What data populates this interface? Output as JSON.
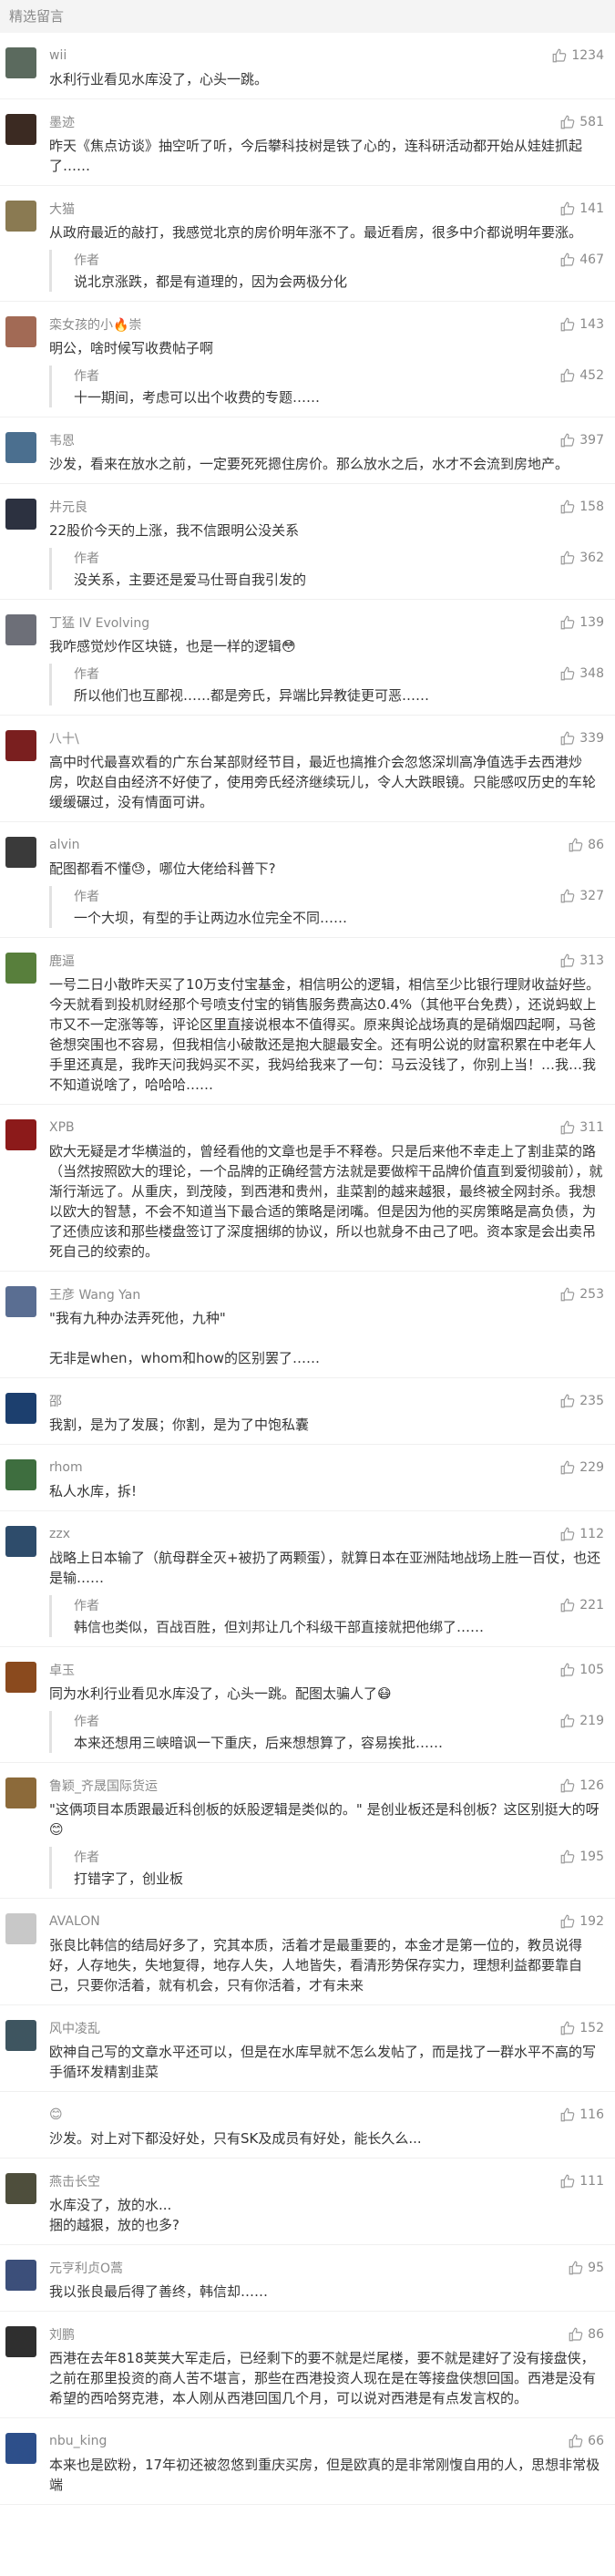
{
  "section_title": "精选留言",
  "comments": [
    {
      "nick": "wii",
      "likes": "1234",
      "text": "水利行业看见水库没了，心头一跳。",
      "color": "#5b6a5e"
    },
    {
      "nick": "墨迹",
      "likes": "581",
      "text": "昨天《焦点访谈》抽空听了听，今后攀科技树是铁了心的，连科研活动都开始从娃娃抓起了……",
      "color": "#3b2a22"
    },
    {
      "nick": "大猫",
      "likes": "141",
      "text": "从政府最近的敲打，我感觉北京的房价明年涨不了。最近看房，很多中介都说明年要涨。",
      "reply_author": "作者",
      "reply_likes": "467",
      "reply_text": "说北京涨跌，都是有道理的，因为会两极分化",
      "color": "#8a7a52"
    },
    {
      "nick": "栾女孩的小🔥崇",
      "likes": "143",
      "text": "明公，啥时候写收费帖子啊",
      "reply_author": "作者",
      "reply_likes": "452",
      "reply_text": "十一期间，考虑可以出个收费的专题……",
      "color": "#a26a55"
    },
    {
      "nick": "韦恩",
      "likes": "397",
      "text": "沙发，看来在放水之前，一定要死死摁住房价。那么放水之后，水才不会流到房地产。",
      "color": "#4b6f8f"
    },
    {
      "nick": "井元良",
      "likes": "158",
      "text": "22股价今天的上涨，我不信跟明公没关系",
      "reply_author": "作者",
      "reply_likes": "362",
      "reply_text": "没关系，主要还是爱马仕哥自我引发的",
      "color": "#2c3140"
    },
    {
      "nick": "丁猛 IV Evolving",
      "likes": "139",
      "text": "我咋感觉炒作区块链，也是一样的逻辑😳",
      "reply_author": "作者",
      "reply_likes": "348",
      "reply_text": "所以他们也互鄙视……都是旁氏，异端比异教徒更可恶……",
      "color": "#6d6f78"
    },
    {
      "nick": "八十\\",
      "likes": "339",
      "text": "高中时代最喜欢看的广东台某部财经节目，最近也搞推介会忽悠深圳高净值选手去西港炒房，吹赵自由经济不好使了，使用旁氏经济继续玩儿，令人大跌眼镜。只能感叹历史的车轮缓缓碾过，没有情面可讲。",
      "color": "#7a1f1f"
    },
    {
      "nick": "alvin",
      "likes": "86",
      "text": "配图都看不懂😓，哪位大佬给科普下?",
      "reply_author": "作者",
      "reply_likes": "327",
      "reply_text": "一个大坝，有型的手让两边水位完全不同……",
      "color": "#3a3a3a"
    },
    {
      "nick": "鹿逼",
      "likes": "313",
      "text": "一号二日小散昨天买了10万支付宝基金，相信明公的逻辑，相信至少比银行理财收益好些。今天就看到投机财经那个号喷支付宝的销售服务费高达0.4%（其他平台免费），还说蚂蚁上市又不一定涨等等，评论区里直接说根本不值得买。原来舆论战场真的是硝烟四起啊，马爸爸想突围也不容易，但我相信小破散还是抱大腿最安全。还有明公说的财富积累在中老年人手里还真是，我昨天问我妈买不买，我妈给我来了一句：马云没钱了，你别上当！…我…我不知道说啥了，哈哈哈……",
      "color": "#587f3c"
    },
    {
      "nick": "XPB",
      "likes": "311",
      "text": "欧大无疑是才华横溢的，曾经看他的文章也是手不释卷。只是后来他不幸走上了割韭菜的路（当然按照欧大的理论，一个品牌的正确经营方法就是要做榨干品牌价值直到爱彻骏前），就渐行渐远了。从重庆，到茂陵，到西港和贵州，韭菜割的越来越狠，最终被全网封杀。我想以欧大的智慧，不会不知道当下最合适的策略是闭嘴。但是因为他的买房策略是高负债，为了还债应该和那些楼盘签订了深度捆绑的协议，所以也就身不由己了吧。资本家是会出卖吊死自己的绞索的。",
      "color": "#8c1a1a"
    },
    {
      "nick": "王彦 Wang Yan",
      "likes": "253",
      "text": "\"我有九种办法弄死他，九种\"\n\n无非是when，whom和how的区别罢了……",
      "color": "#5a6e92"
    },
    {
      "nick": "邵",
      "likes": "235",
      "text": "我割，是为了发展；你割，是为了中饱私囊",
      "color": "#1c3f6e"
    },
    {
      "nick": "rhom",
      "likes": "229",
      "text": "私人水库，拆!",
      "color": "#3e6e3f"
    },
    {
      "nick": "zzx",
      "likes": "112",
      "text": "战略上日本输了（航母群全灭+被扔了两颗蛋），就算日本在亚洲陆地战场上胜一百仗，也还是输……",
      "reply_author": "作者",
      "reply_likes": "221",
      "reply_text": "韩信也类似，百战百胜，但刘邦让几个科级干部直接就把他绑了……",
      "color": "#2e4c6b"
    },
    {
      "nick": "卓玉",
      "likes": "105",
      "text": "同为水利行业看见水库没了，心头一跳。配图太骗人了😷",
      "reply_author": "作者",
      "reply_likes": "219",
      "reply_text": "本来还想用三峡暗讽一下重庆，后来想想算了，容易挨批……",
      "color": "#8a4a1e"
    },
    {
      "nick": "鲁颖_齐晟国际货运",
      "likes": "126",
      "text": "\"这俩项目本质跟最近科创板的妖股逻辑是类似的。\" 是创业板还是科创板？这区别挺大的呀😊",
      "reply_author": "作者",
      "reply_likes": "195",
      "reply_text": "打错字了，创业板",
      "color": "#8c6a3a"
    },
    {
      "nick": "AVALON",
      "likes": "192",
      "text": "张良比韩信的结局好多了，究其本质，活着才是最重要的，本金才是第一位的，教员说得好，人存地失，失地复得，地存人失，人地皆失，看清形势保存实力，理想利益都要靠自己，只要你活着，就有机会，只有你活着，才有未来",
      "color": "#c8c8c8"
    },
    {
      "nick": "风中凌乱",
      "likes": "152",
      "text": "欧神自己写的文章水平还可以，但是在水库早就不怎么发帖了，而是找了一群水平不高的写手循环发精割韭菜",
      "color": "#3e5560"
    },
    {
      "nick": "😊",
      "likes": "116",
      "text": "沙发。对上对下都没好处，只有SK及成员有好处，能长久么...",
      "color": "#ffffff"
    },
    {
      "nick": "燕击长空",
      "likes": "111",
      "text": "水库没了，放的水...\n捆的越狠，放的也多?",
      "color": "#4e4e3c"
    },
    {
      "nick": "元亨利贞O蒿",
      "likes": "95",
      "text": "我以张良最后得了善终，韩信却……",
      "color": "#3c4f7a"
    },
    {
      "nick": "刘鹏",
      "likes": "86",
      "text": "西港在去年818荚荚大军走后，已经剩下的要不就是烂尾楼，要不就是建好了没有接盘侠，之前在那里投资的商人苦不堪言，那些在西港投资人现在是在等接盘侠想回国。西港是没有希望的西哈努克港，本人刚从西港回国几个月，可以说对西港是有点发言权的。",
      "color": "#2f2f2f"
    },
    {
      "nick": "nbu_king",
      "likes": "66",
      "text": "本来也是欧粉，17年初还被忽悠到重庆买房，但是欧真的是非常刚愎自用的人，思想非常极端",
      "color": "#2d4f8a"
    }
  ]
}
